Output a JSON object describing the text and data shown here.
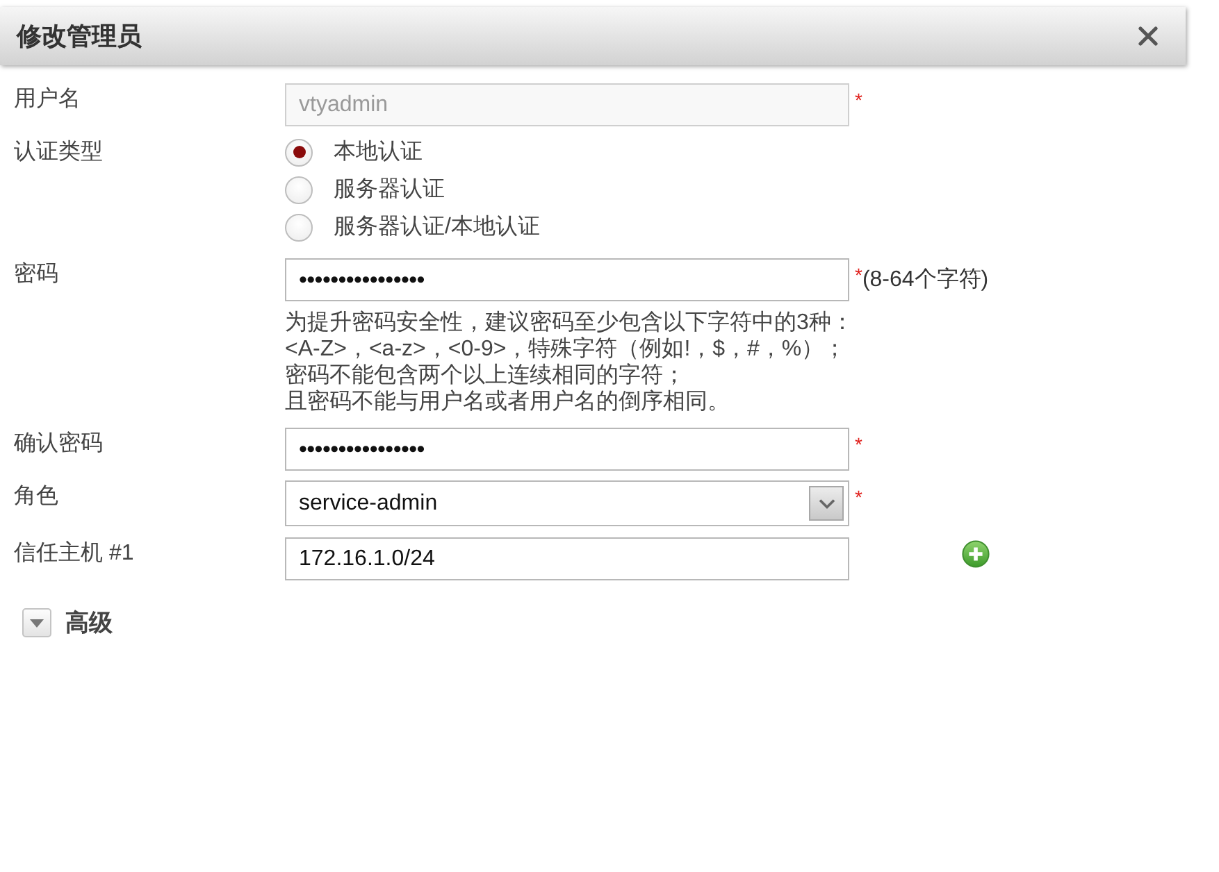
{
  "dialog": {
    "title": "修改管理员"
  },
  "fields": [
    {
      "kind": "text",
      "label": "用户名",
      "value": "vtyadmin",
      "disabled": true,
      "required_mark": "*"
    },
    {
      "kind": "radio",
      "label": "认证类型",
      "options": [
        {
          "label": "本地认证",
          "selected": true
        },
        {
          "label": "服务器认证",
          "selected": false
        },
        {
          "label": "服务器认证/本地认证",
          "selected": false
        }
      ]
    },
    {
      "kind": "password",
      "label": "密码",
      "value": "••••••••••••••••",
      "disabled": false,
      "required_mark": "*",
      "note": "(8-64个字符)",
      "hint_lines": [
        "为提升密码安全性，建议密码至少包含以下字符中的3种：",
        "<A-Z>，<a-z>，<0-9>，特殊字符（例如!，$，#，%）；",
        "密码不能包含两个以上连续相同的字符；",
        "且密码不能与用户名或者用户名的倒序相同。"
      ]
    },
    {
      "kind": "password",
      "label": "确认密码",
      "value": "••••••••••••••••",
      "disabled": false,
      "required_mark": "*"
    },
    {
      "kind": "select",
      "label": "角色",
      "value": "service-admin",
      "disabled": false,
      "required_mark": "*"
    },
    {
      "kind": "text",
      "label": "信任主机 #1",
      "value": "172.16.1.0/24",
      "disabled": false,
      "add_button": true
    }
  ],
  "advanced": {
    "label": "高级"
  }
}
